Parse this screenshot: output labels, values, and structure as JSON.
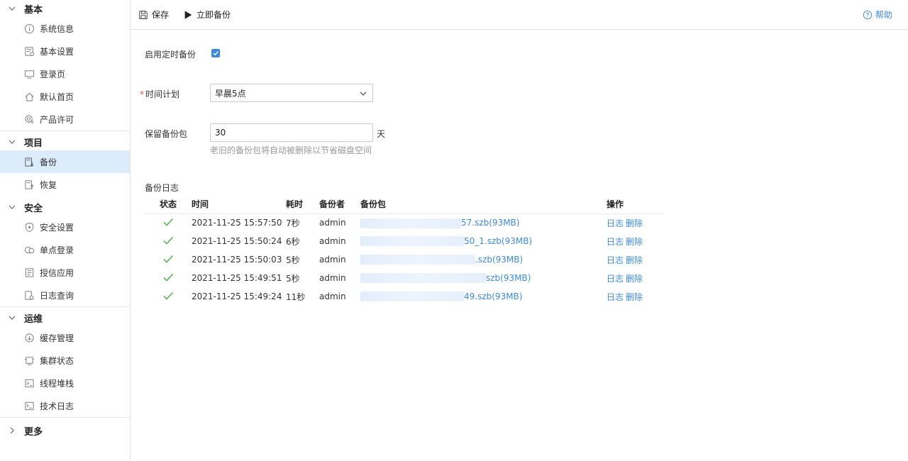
{
  "sidebar": {
    "groups": [
      {
        "label": "基本",
        "items": [
          "系统信息",
          "基本设置",
          "登录页",
          "默认首页",
          "产品许可"
        ]
      },
      {
        "label": "项目",
        "items": [
          "备份",
          "恢复"
        ]
      },
      {
        "label": "安全",
        "items": [
          "安全设置",
          "单点登录",
          "授信应用",
          "日志查询"
        ]
      },
      {
        "label": "运维",
        "items": [
          "缓存管理",
          "集群状态",
          "线程堆栈",
          "技术日志"
        ]
      },
      {
        "label": "更多",
        "items": []
      }
    ],
    "active_item": "备份"
  },
  "toolbar": {
    "save_label": "保存",
    "backup_now_label": "立即备份",
    "help_label": "帮助"
  },
  "form": {
    "enable_label": "启用定时备份",
    "enable_checked": true,
    "schedule_label": "时间计划",
    "schedule_required_mark": "*",
    "schedule_value": "早晨5点",
    "keep_label": "保留备份包",
    "keep_value": "30",
    "keep_unit": "天",
    "keep_hint": "老旧的备份包将自动被删除以节省磁盘空间"
  },
  "log": {
    "title": "备份日志",
    "columns": {
      "status": "状态",
      "time": "时间",
      "duration": "耗时",
      "user": "备份者",
      "package": "备份包",
      "ops": "操作"
    },
    "rows": [
      {
        "time": "2021-11-25 15:57:50",
        "duration": "7秒",
        "user": "admin",
        "package_prefix": "",
        "package_visible": "57.szb(93MB)"
      },
      {
        "time": "2021-11-25 15:50:24",
        "duration": "6秒",
        "user": "admin",
        "package_prefix": "",
        "package_visible": "50_1.szb(93MB)"
      },
      {
        "time": "2021-11-25 15:50:03",
        "duration": "5秒",
        "user": "admin",
        "package_prefix": "",
        "package_visible": ".szb(93MB)"
      },
      {
        "time": "2021-11-25 15:49:51",
        "duration": "5秒",
        "user": "admin",
        "package_prefix": "",
        "package_visible": "szb(93MB)"
      },
      {
        "time": "2021-11-25 15:49:24",
        "duration": "11秒",
        "user": "admin",
        "package_prefix": "",
        "package_visible": "49.szb(93MB)"
      }
    ],
    "op_log": "日志",
    "op_delete": "删除"
  },
  "colors": {
    "accent": "#3d8bd9",
    "success": "#4caf50",
    "active_bg": "#dcecfa"
  }
}
